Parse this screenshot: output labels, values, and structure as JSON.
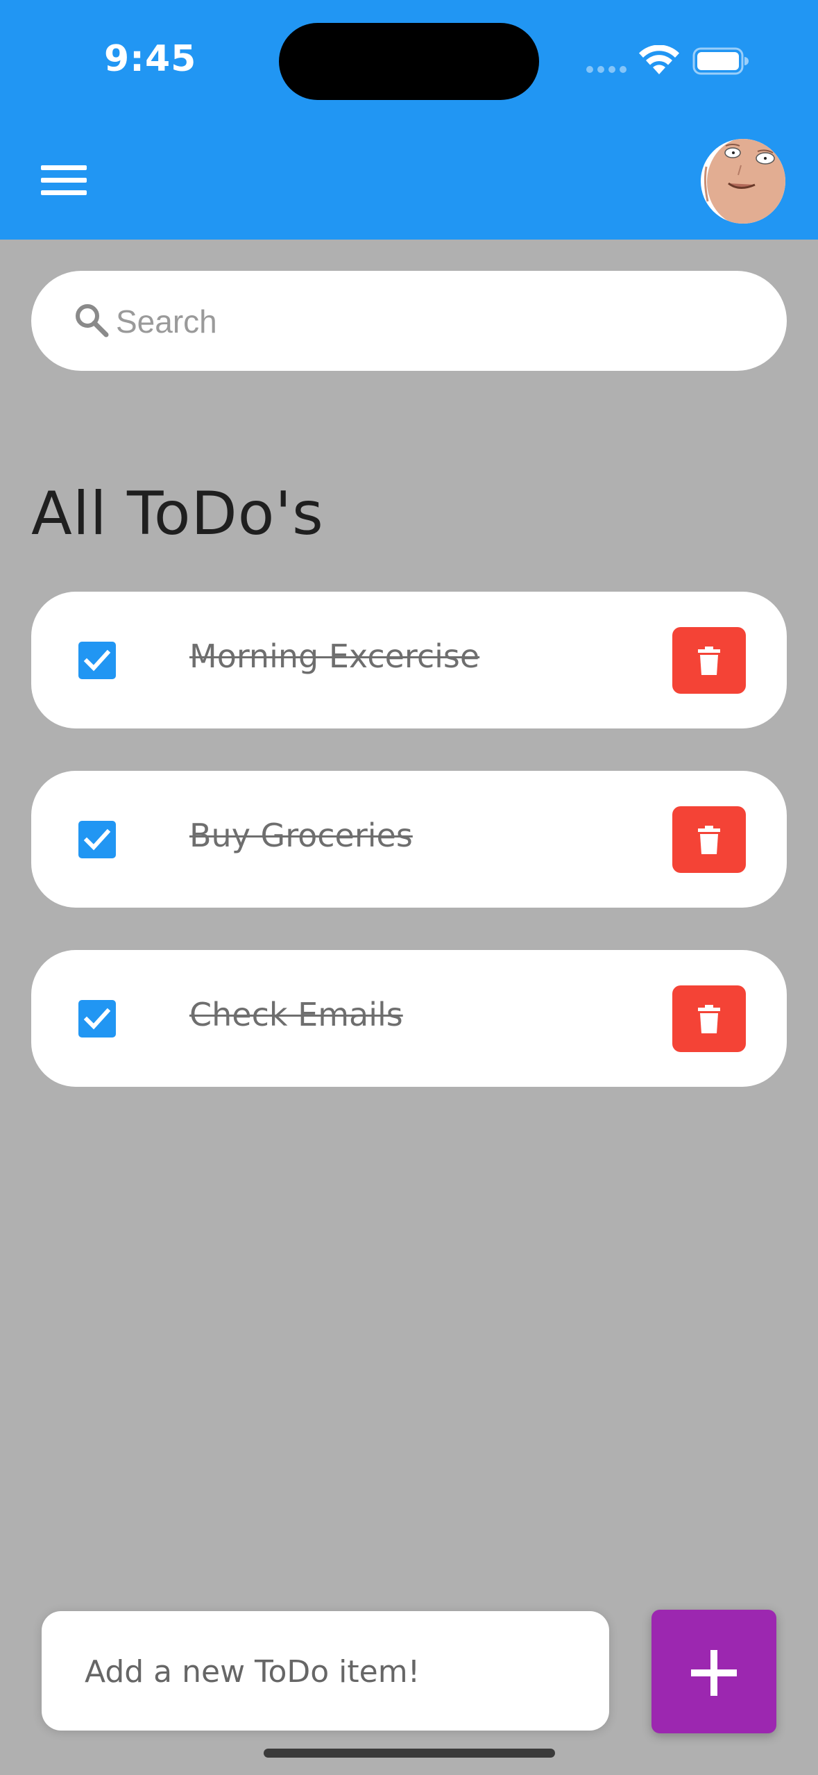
{
  "status_bar": {
    "time": "9:45"
  },
  "app_bar": {
    "menu_icon": "hamburger-menu-icon",
    "avatar": "user-avatar"
  },
  "search": {
    "placeholder": "Search",
    "value": "",
    "icon": "search-icon"
  },
  "section_title": "All ToDo's",
  "todos": [
    {
      "text": "Morning Excercise",
      "done": true
    },
    {
      "text": "Buy Groceries",
      "done": true
    },
    {
      "text": "Check Emails",
      "done": true
    }
  ],
  "new_todo": {
    "placeholder": "Add a new ToDo item!",
    "value": ""
  },
  "add_button": {
    "icon": "plus-icon"
  },
  "colors": {
    "app_bar": "#2196f3",
    "background": "#b0b0b0",
    "checkbox": "#2196f3",
    "delete": "#f44336",
    "add_button": "#9c27b0"
  }
}
